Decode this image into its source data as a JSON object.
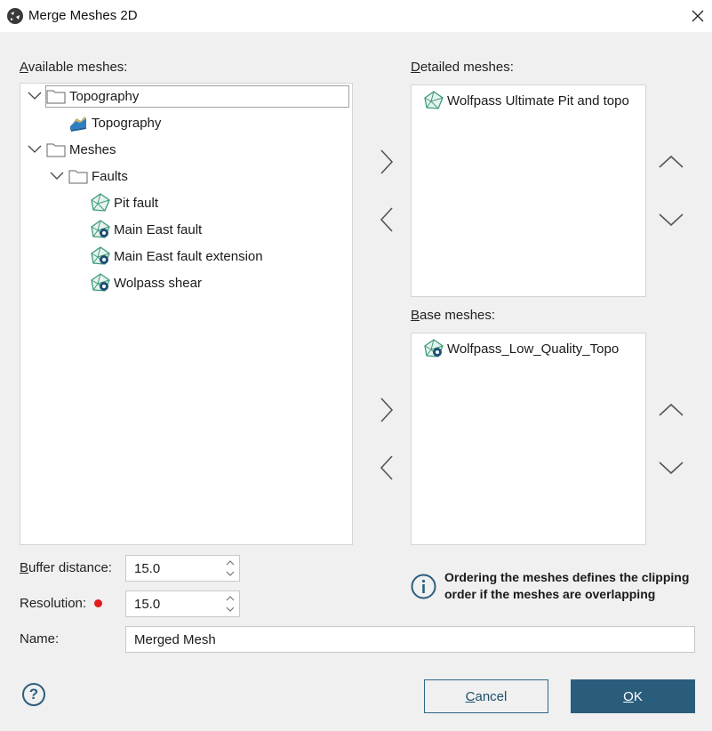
{
  "window": {
    "title": "Merge Meshes 2D",
    "app_icon": "leapfrog-app-icon",
    "close_icon": "close-icon"
  },
  "available": {
    "label_accel": "A",
    "label_rest": "vailable meshes:",
    "tree": [
      {
        "label": "Topography",
        "type": "folder",
        "expanded": true,
        "selected": true
      },
      {
        "label": "Topography",
        "type": "topography"
      },
      {
        "label": "Meshes",
        "type": "folder",
        "expanded": true
      },
      {
        "label": "Faults",
        "type": "folder",
        "expanded": true
      },
      {
        "label": "Pit fault",
        "type": "mesh"
      },
      {
        "label": "Main East fault",
        "type": "mesh-gear"
      },
      {
        "label": "Main East fault extension",
        "type": "mesh-gear"
      },
      {
        "label": "Wolpass shear",
        "type": "mesh-gear"
      }
    ]
  },
  "detailed": {
    "label_accel": "D",
    "label_rest": "etailed meshes:",
    "items": [
      {
        "label": "Wolfpass Ultimate Pit and topo",
        "type": "mesh"
      }
    ]
  },
  "base": {
    "label_accel": "B",
    "label_rest": "ase meshes:",
    "items": [
      {
        "label": "Wolfpass_Low_Quality_Topo",
        "type": "mesh-gear"
      }
    ]
  },
  "form": {
    "buffer_label_accel": "B",
    "buffer_label_rest": "uffer distance:",
    "buffer_value": "15.0",
    "resolution_label": "Resolution:",
    "resolution_value": "15.0",
    "name_label": "Name:",
    "name_value": "Merged Mesh"
  },
  "info": {
    "text": "Ordering the meshes defines the clipping order if the meshes are overlapping",
    "icon": "info-icon"
  },
  "buttons": {
    "help": "?",
    "cancel_accel": "C",
    "cancel_rest": "ancel",
    "ok_accel": "O",
    "ok_rest": "K"
  },
  "colors": {
    "accent": "#2a5d7c",
    "mesh_icon": "#3f9a7a",
    "required_dot": "#e21b1b"
  }
}
